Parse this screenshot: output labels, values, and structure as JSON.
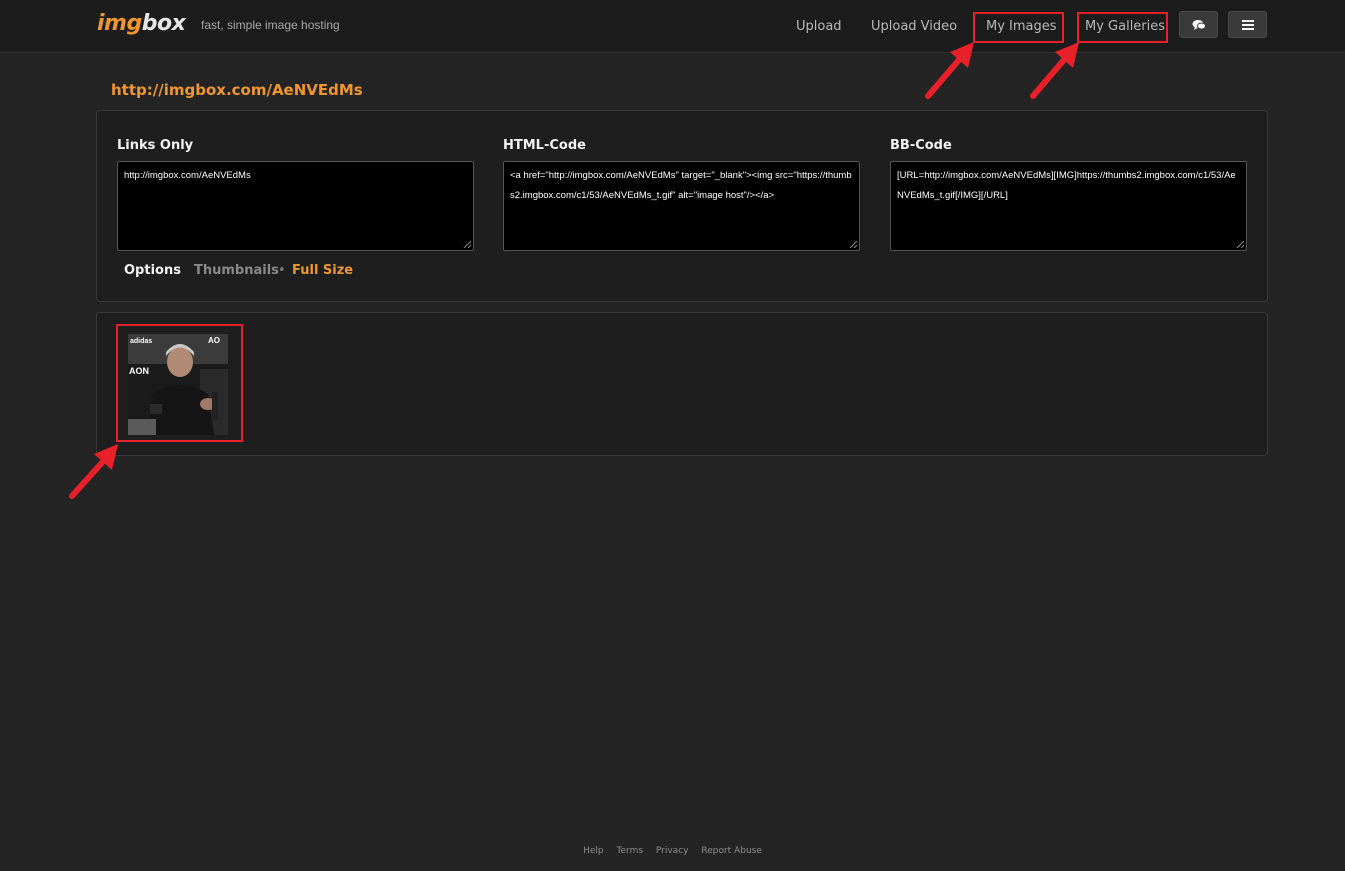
{
  "header": {
    "logo_part1": "img",
    "logo_part2": "box",
    "tagline": "fast, simple image hosting",
    "nav": {
      "upload": "Upload",
      "upload_video": "Upload Video",
      "my_images": "My Images",
      "my_galleries": "My Galleries"
    },
    "buttons": [
      "chat-icon",
      "menu-icon"
    ]
  },
  "share_url": "http://imgbox.com/AeNVEdMs",
  "codes": {
    "links_only": {
      "label": "Links Only",
      "value": "http://imgbox.com/AeNVEdMs"
    },
    "html_code": {
      "label": "HTML-Code",
      "value": "<a href=\"http://imgbox.com/AeNVEdMs\" target=\"_blank\"><img src=\"https://thumbs2.imgbox.com/c1/53/AeNVEdMs_t.gif\" alt=\"image host\"/></a>"
    },
    "bb_code": {
      "label": "BB-Code",
      "value": "[URL=http://imgbox.com/AeNVEdMs][IMG]https://thumbs2.imgbox.com/c1/53/AeNVEdMs_t.gif[/IMG][/URL]"
    }
  },
  "options": {
    "label": "Options",
    "thumbnails": "Thumbnails",
    "separator": "•",
    "full_size": "Full Size"
  },
  "thumbnail": {
    "logo_text_top": "adidas",
    "logo_text_side": "AON"
  },
  "footer": {
    "links": [
      "Help",
      "Terms",
      "Privacy",
      "Report Abuse"
    ]
  },
  "colors": {
    "accent": "#f0962f",
    "highlight": "#e8202a",
    "background": "#242424"
  }
}
